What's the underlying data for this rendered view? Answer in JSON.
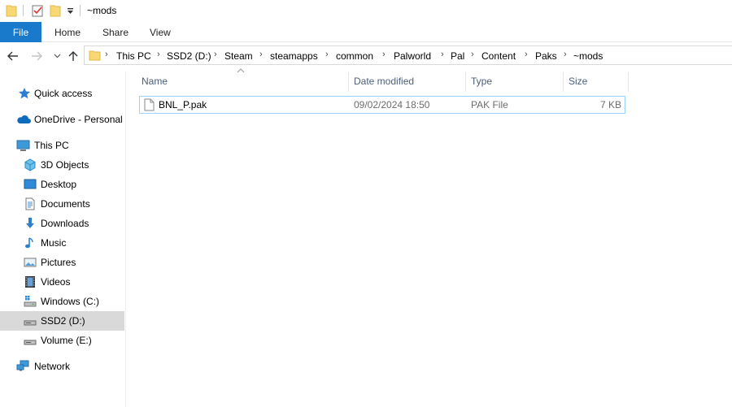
{
  "window": {
    "title": "~mods"
  },
  "quick_access_toolbar": {
    "icons": [
      "folder-icon",
      "properties-icon",
      "new-folder-icon",
      "customize-dropdown-icon"
    ]
  },
  "ribbon": {
    "tabs": [
      {
        "label": "File",
        "active": true
      },
      {
        "label": "Home"
      },
      {
        "label": "Share"
      },
      {
        "label": "View"
      }
    ]
  },
  "address": {
    "path": [
      "This PC",
      "SSD2 (D:)",
      "Steam",
      "steamapps",
      "common",
      "Palworld",
      "Pal",
      "Content",
      "Paks",
      "~mods"
    ]
  },
  "sidebar": {
    "items": [
      {
        "label": "Quick access",
        "icon": "star-icon"
      },
      {
        "label": "OneDrive - Personal",
        "icon": "cloud-icon"
      },
      {
        "label": "This PC",
        "icon": "computer-icon"
      },
      {
        "label": "3D Objects",
        "icon": "cube-icon"
      },
      {
        "label": "Desktop",
        "icon": "desktop-icon"
      },
      {
        "label": "Documents",
        "icon": "documents-icon"
      },
      {
        "label": "Downloads",
        "icon": "download-icon"
      },
      {
        "label": "Music",
        "icon": "music-icon"
      },
      {
        "label": "Pictures",
        "icon": "pictures-icon"
      },
      {
        "label": "Videos",
        "icon": "videos-icon"
      },
      {
        "label": "Windows (C:)",
        "icon": "windows-drive-icon"
      },
      {
        "label": "SSD2 (D:)",
        "icon": "drive-icon",
        "selected": true
      },
      {
        "label": "Volume (E:)",
        "icon": "drive-icon"
      },
      {
        "label": "Network",
        "icon": "network-icon"
      }
    ]
  },
  "columns": {
    "name": "Name",
    "date_modified": "Date modified",
    "type": "Type",
    "size": "Size"
  },
  "files": [
    {
      "name": "BNL_P.pak",
      "date_modified": "09/02/2024 18:50",
      "type": "PAK File",
      "size": "7 KB",
      "icon": "file-icon"
    }
  ],
  "colors": {
    "accent": "#1979ca",
    "selection_border": "#99d1ff",
    "selected_nav": "#d9d9d9"
  }
}
